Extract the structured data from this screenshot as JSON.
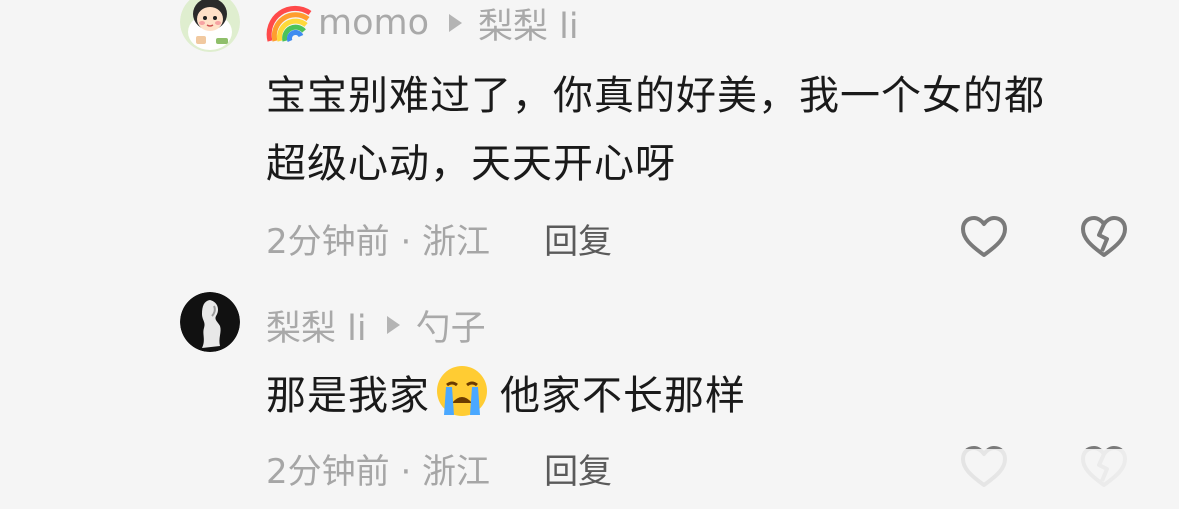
{
  "comments": [
    {
      "author": "momo",
      "reply_to": "梨梨 li",
      "body_line1": "宝宝别难过了，你真的好美，我一个女的都",
      "body_line2": "超级心动，天天开心呀",
      "time_location": "2分钟前 · 浙江",
      "reply_label": "回复",
      "author_badge_icon": "rainbow-icon",
      "avatar_icon": "cartoon-girl-avatar"
    },
    {
      "author": "梨梨 li",
      "reply_to": "勺子",
      "body_before_emoji": "那是我家",
      "emoji_icon": "crying-face-emoji",
      "body_after_emoji": "他家不长那样",
      "time_location": "2分钟前 · 浙江",
      "reply_label": "回复",
      "avatar_icon": "bw-photo-avatar"
    }
  ],
  "colors": {
    "background": "#f5f5f5",
    "text_primary": "#1a1a1a",
    "text_secondary": "#a6a6a6",
    "icon_gray": "#7a7a7a"
  }
}
